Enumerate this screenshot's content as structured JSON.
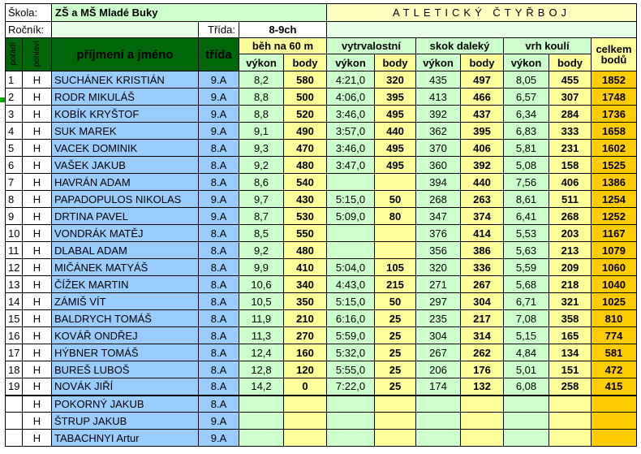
{
  "header": {
    "school_label": "Škola:",
    "school_name": "ZŠ a MŠ Mladé Buky",
    "title": "ATLETICKÝ ČTYŘBOJ",
    "year_label": "Ročník:",
    "class_label": "Třída:",
    "grade": "8-9ch"
  },
  "columns": {
    "rank": "pořadí",
    "sex": "pohlaví",
    "name": "příjmení a jméno",
    "class": "třída",
    "run60": "běh na 60 m",
    "endurance": "vytrvalostní",
    "long_jump": "skok daleký",
    "shot_put": "vrh koulí",
    "total": "celkem bodů",
    "perf": "výkon",
    "pts": "body"
  },
  "rows": [
    {
      "rank": "1",
      "sex": "H",
      "name": "SUCHÁNEK KRISTIÁN",
      "cls": "9.A",
      "r60": "8,2",
      "p60": "580",
      "end": "4:21,0",
      "pend": "320",
      "lj": "435",
      "plj": "497",
      "sp": "8,05",
      "psp": "455",
      "total": "1852"
    },
    {
      "rank": "2",
      "sex": "H",
      "name": "RODR MIKULÁŠ",
      "cls": "9.A",
      "r60": "8,8",
      "p60": "500",
      "end": "4:06,0",
      "pend": "395",
      "lj": "413",
      "plj": "466",
      "sp": "6,57",
      "psp": "307",
      "total": "1748"
    },
    {
      "rank": "3",
      "sex": "H",
      "name": "KOBÍK KRYŠTOF",
      "cls": "9.A",
      "r60": "8,8",
      "p60": "520",
      "end": "3:46,0",
      "pend": "495",
      "lj": "392",
      "plj": "437",
      "sp": "6,34",
      "psp": "284",
      "total": "1736"
    },
    {
      "rank": "4",
      "sex": "H",
      "name": "SUK MAREK",
      "cls": "9.A",
      "r60": "9,1",
      "p60": "490",
      "end": "3:57,0",
      "pend": "440",
      "lj": "362",
      "plj": "395",
      "sp": "6,83",
      "psp": "333",
      "total": "1658"
    },
    {
      "rank": "5",
      "sex": "H",
      "name": "VACEK DOMINIK",
      "cls": "8.A",
      "r60": "9,3",
      "p60": "470",
      "end": "3:46,0",
      "pend": "495",
      "lj": "370",
      "plj": "406",
      "sp": "5,81",
      "psp": "231",
      "total": "1602"
    },
    {
      "rank": "6",
      "sex": "H",
      "name": "VAŠEK JAKUB",
      "cls": "8.A",
      "r60": "9,2",
      "p60": "480",
      "end": "3:47,0",
      "pend": "495",
      "lj": "360",
      "plj": "392",
      "sp": "5,08",
      "psp": "158",
      "total": "1525"
    },
    {
      "rank": "7",
      "sex": "H",
      "name": "HAVRÁN ADAM",
      "cls": "8.A",
      "r60": "8,6",
      "p60": "540",
      "end": "",
      "pend": "",
      "lj": "394",
      "plj": "440",
      "sp": "7,56",
      "psp": "406",
      "total": "1386"
    },
    {
      "rank": "8",
      "sex": "H",
      "name": "PAPADOPULOS NIKOLAS",
      "cls": "9.A",
      "r60": "9,7",
      "p60": "430",
      "end": "5:15,0",
      "pend": "50",
      "lj": "268",
      "plj": "263",
      "sp": "8,61",
      "psp": "511",
      "total": "1254"
    },
    {
      "rank": "9",
      "sex": "H",
      "name": "DRTINA PAVEL",
      "cls": "9.A",
      "r60": "8,7",
      "p60": "530",
      "end": "5:09,0",
      "pend": "80",
      "lj": "347",
      "plj": "374",
      "sp": "6,41",
      "psp": "268",
      "total": "1252"
    },
    {
      "rank": "10",
      "sex": "H",
      "name": "VONDRÁK MATĚJ",
      "cls": "8.A",
      "r60": "8,5",
      "p60": "550",
      "end": "",
      "pend": "",
      "lj": "376",
      "plj": "414",
      "sp": "5,53",
      "psp": "203",
      "total": "1167"
    },
    {
      "rank": "11",
      "sex": "H",
      "name": "DLABAL ADAM",
      "cls": "8.A",
      "r60": "9,2",
      "p60": "480",
      "end": "",
      "pend": "",
      "lj": "356",
      "plj": "386",
      "sp": "5,63",
      "psp": "213",
      "total": "1079"
    },
    {
      "rank": "12",
      "sex": "H",
      "name": "MIČÁNEK MATYÁŠ",
      "cls": "8.A",
      "r60": "9,9",
      "p60": "410",
      "end": "5:04,0",
      "pend": "105",
      "lj": "320",
      "plj": "336",
      "sp": "5,59",
      "psp": "209",
      "total": "1060"
    },
    {
      "rank": "13",
      "sex": "H",
      "name": "ČÍŽEK MARTIN",
      "cls": "8.A",
      "r60": "10,6",
      "p60": "340",
      "end": "4:43,0",
      "pend": "215",
      "lj": "271",
      "plj": "267",
      "sp": "5,68",
      "psp": "218",
      "total": "1040"
    },
    {
      "rank": "14",
      "sex": "H",
      "name": "ZÁMIŠ VÍT",
      "cls": "8.A",
      "r60": "10,5",
      "p60": "350",
      "end": "5:15,0",
      "pend": "50",
      "lj": "297",
      "plj": "304",
      "sp": "6,71",
      "psp": "321",
      "total": "1025"
    },
    {
      "rank": "15",
      "sex": "H",
      "name": "BALDRYCH TOMÁŠ",
      "cls": "8.A",
      "r60": "11,9",
      "p60": "210",
      "end": "6:16,0",
      "pend": "25",
      "lj": "235",
      "plj": "217",
      "sp": "7,08",
      "psp": "358",
      "total": "810"
    },
    {
      "rank": "16",
      "sex": "H",
      "name": "KOVÁŘ ONDŘEJ",
      "cls": "8.A",
      "r60": "11,3",
      "p60": "270",
      "end": "5:59,0",
      "pend": "25",
      "lj": "304",
      "plj": "314",
      "sp": "5,15",
      "psp": "165",
      "total": "774"
    },
    {
      "rank": "17",
      "sex": "H",
      "name": "HÝBNER TOMÁŠ",
      "cls": "8.A",
      "r60": "12,4",
      "p60": "160",
      "end": "5:32,0",
      "pend": "25",
      "lj": "267",
      "plj": "262",
      "sp": "4,84",
      "psp": "134",
      "total": "581"
    },
    {
      "rank": "18",
      "sex": "H",
      "name": "BUREŠ LUBOŠ",
      "cls": "8.A",
      "r60": "12,8",
      "p60": "120",
      "end": "5:55,0",
      "pend": "25",
      "lj": "206",
      "plj": "176",
      "sp": "5,01",
      "psp": "151",
      "total": "472"
    },
    {
      "rank": "19",
      "sex": "H",
      "name": "NOVÁK JIŘÍ",
      "cls": "8.A",
      "r60": "14,2",
      "p60": "0",
      "end": "7:22,0",
      "pend": "25",
      "lj": "174",
      "plj": "132",
      "sp": "6,08",
      "psp": "258",
      "total": "415"
    }
  ],
  "unranked": [
    {
      "sex": "H",
      "name": "POKORNÝ JAKUB",
      "cls": "8.A"
    },
    {
      "sex": "H",
      "name": "ŠTRUP JAKUB",
      "cls": "9.A"
    },
    {
      "sex": "H",
      "name": "TABACHNYI Artur",
      "cls": "9.A"
    }
  ]
}
